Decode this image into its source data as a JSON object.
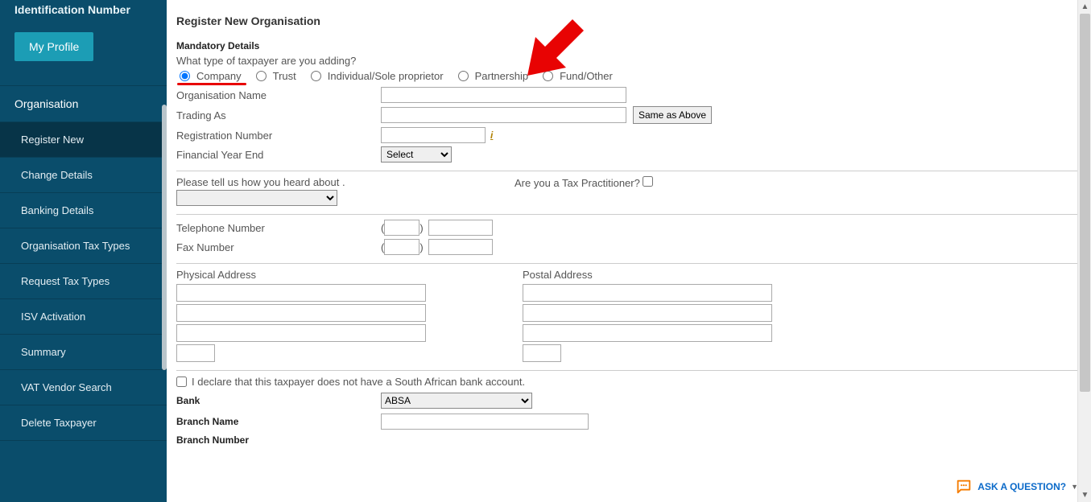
{
  "sidebar": {
    "header": "Identification Number",
    "profile_button": "My Profile",
    "section": "Organisation",
    "items": [
      {
        "label": "Register New"
      },
      {
        "label": "Change Details"
      },
      {
        "label": "Banking Details"
      },
      {
        "label": "Organisation Tax Types"
      },
      {
        "label": "Request Tax Types"
      },
      {
        "label": "ISV Activation"
      },
      {
        "label": "Summary"
      },
      {
        "label": "VAT Vendor Search"
      },
      {
        "label": "Delete Taxpayer"
      }
    ]
  },
  "form": {
    "title": "Register New Organisation",
    "mandatory_label": "Mandatory Details",
    "question": "What type of taxpayer are you adding?",
    "radios": {
      "company": "Company",
      "trust": "Trust",
      "individual": "Individual/Sole proprietor",
      "partnership": "Partnership",
      "fund": "Fund/Other"
    },
    "org_name": "Organisation Name",
    "trading_as": "Trading As",
    "same_as_above": "Same as Above",
    "registration_number": "Registration Number",
    "financial_year_end": "Financial Year End",
    "fye_select": "Select",
    "heard_about": "Please tell us how you heard about .",
    "practitioner": "Are you a Tax Practitioner?",
    "telephone": "Telephone Number",
    "fax": "Fax Number",
    "physical_address": "Physical Address",
    "postal_address": "Postal Address",
    "declare": "I declare that this taxpayer does not have a South African bank account.",
    "bank": "Bank",
    "bank_selected": "ABSA",
    "branch_name": "Branch Name",
    "branch_number": "Branch Number"
  },
  "footer": {
    "ask": "ASK A QUESTION?"
  }
}
